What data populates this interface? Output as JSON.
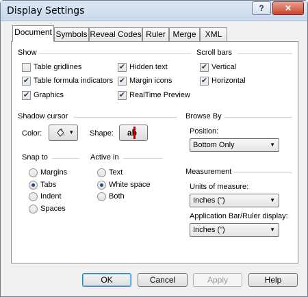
{
  "window": {
    "title": "Display Settings",
    "help_glyph": "?",
    "close_glyph": "✕"
  },
  "tabs": [
    {
      "label": "Document",
      "active": true
    },
    {
      "label": "Symbols"
    },
    {
      "label": "Reveal Codes"
    },
    {
      "label": "Ruler"
    },
    {
      "label": "Merge"
    },
    {
      "label": "XML"
    }
  ],
  "show": {
    "heading": "Show",
    "items": [
      {
        "label": "Table gridlines",
        "checked": false
      },
      {
        "label": "Table formula indicators",
        "checked": true
      },
      {
        "label": "Graphics",
        "checked": true
      },
      {
        "label": "Hidden text",
        "checked": true
      },
      {
        "label": "Margin icons",
        "checked": true
      },
      {
        "label": "RealTime Preview",
        "checked": true
      }
    ]
  },
  "scroll_bars": {
    "heading": "Scroll bars",
    "items": [
      {
        "label": "Vertical",
        "checked": true
      },
      {
        "label": "Horizontal",
        "checked": true
      }
    ]
  },
  "shadow_cursor": {
    "heading": "Shadow cursor",
    "color_label": "Color:",
    "shape_label": "Shape:",
    "shape_glyph": "ab",
    "dropdown_glyph": "▾"
  },
  "browse_by": {
    "heading": "Browse By",
    "position_label": "Position:",
    "position_value": "Bottom Only"
  },
  "snap_to": {
    "heading": "Snap to",
    "options": [
      {
        "label": "Margins",
        "selected": false
      },
      {
        "label": "Tabs",
        "selected": true
      },
      {
        "label": "Indent",
        "selected": false
      },
      {
        "label": "Spaces",
        "selected": false
      }
    ]
  },
  "active_in": {
    "heading": "Active in",
    "options": [
      {
        "label": "Text",
        "selected": false
      },
      {
        "label": "White space",
        "selected": true
      },
      {
        "label": "Both",
        "selected": false
      }
    ]
  },
  "measurement": {
    "heading": "Measurement",
    "units_label": "Units of measure:",
    "units_value": "Inches (\")",
    "appbar_label": "Application Bar/Ruler display:",
    "appbar_value": "Inches (\")"
  },
  "buttons": {
    "ok": "OK",
    "cancel": "Cancel",
    "apply": "Apply",
    "help": "Help"
  },
  "colors": {
    "accent": "#1f4b8a",
    "cursor_shape_mark": "#c00000"
  },
  "icons": {
    "checkmark": "✔",
    "combo_arrow": "▼"
  }
}
